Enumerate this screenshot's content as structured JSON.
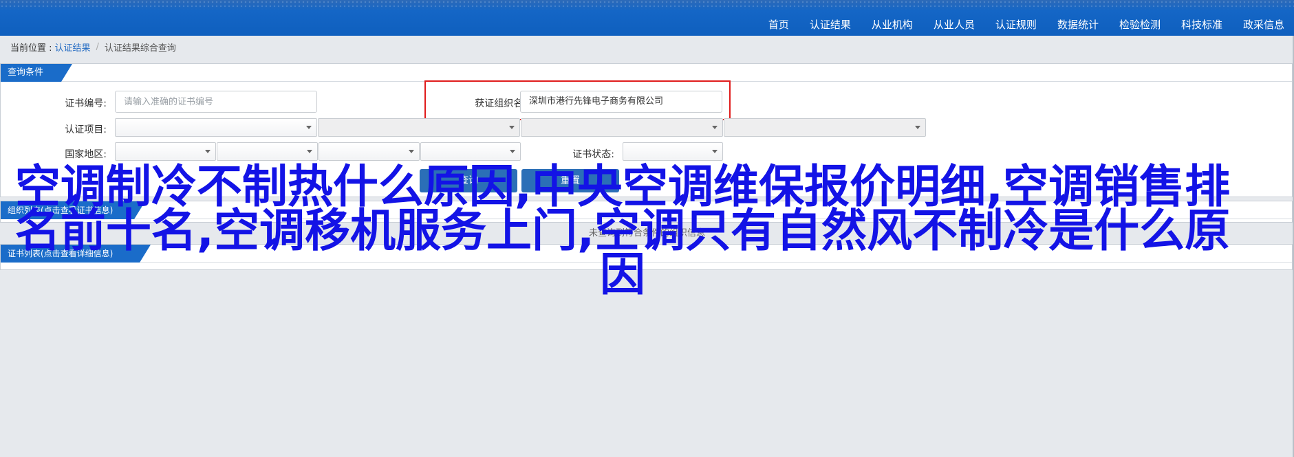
{
  "nav": {
    "items": [
      "首页",
      "认证结果",
      "从业机构",
      "从业人员",
      "认证规则",
      "数据统计",
      "检验检测",
      "科技标准",
      "政采信息"
    ]
  },
  "breadcrumb": {
    "prefix": "当前位置 :",
    "link": "认证结果",
    "sep": "/",
    "current": "认证结果综合查询"
  },
  "query_panel": {
    "title": "查询条件",
    "cert_no_label": "证书编号:",
    "cert_no_placeholder": "请输入准确的证书编号",
    "org_label": "获证组织名称:",
    "org_value": "深圳市港行先锋电子商务有限公司",
    "project_label": "认证项目:",
    "region_label": "国家地区:",
    "status_label": "证书状态:",
    "search_button": "查询",
    "reset_button": "重置"
  },
  "org_panel": {
    "title": "组织列表(点击查看证书信息)",
    "empty_message": "未查询到符合条件的组织信息"
  },
  "cert_panel": {
    "title": "证书列表(点击查看详细信息)"
  },
  "overlay_text": "空调制冷不制热什么原因,中央空调维保报价明细,空调销售排名前十名,空调移机服务上门,空调只有自然风不制冷是什么原因",
  "colors": {
    "nav_bg": "#0f5fbe",
    "tab_bg": "#1a6cc9",
    "button_bg": "#2b6fb7",
    "overlay_text": "#1313e6",
    "highlight_border": "#e01b1b"
  }
}
